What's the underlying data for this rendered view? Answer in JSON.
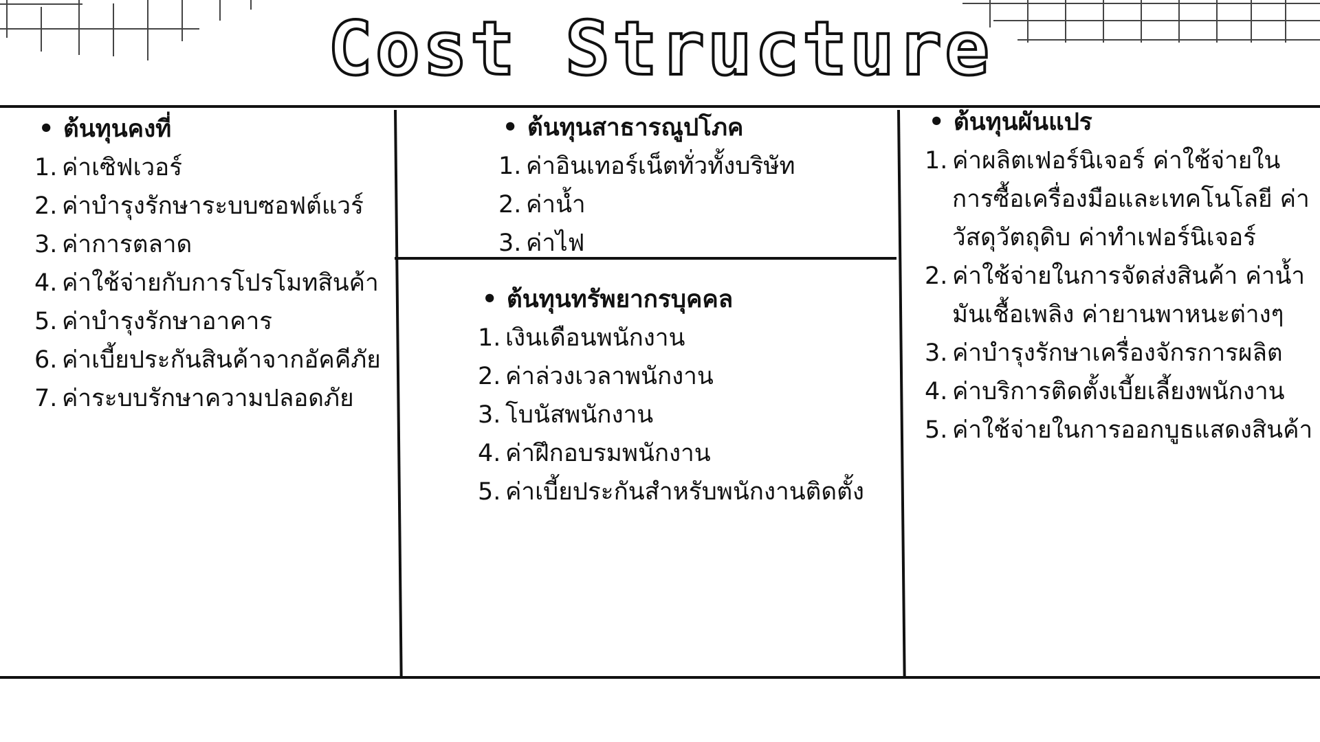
{
  "title": "Cost Structure",
  "colors": {
    "ink": "#111111",
    "background": "#ffffff"
  },
  "sections": {
    "fixed": {
      "heading": "ต้นทุนคงที่",
      "items": [
        {
          "num": "1.",
          "text": "ค่าเซิฟเวอร์"
        },
        {
          "num": "2.",
          "text": "ค่าบำรุงรักษาระบบซอฟต์แวร์"
        },
        {
          "num": "3.",
          "text": "ค่าการตลาด"
        },
        {
          "num": "4.",
          "text": "ค่าใช้จ่ายกับการโปรโมทสินค้า"
        },
        {
          "num": "5.",
          "text": "ค่าบำรุงรักษาอาคาร"
        },
        {
          "num": "6.",
          "text": "ค่าเบี้ยประกันสินค้าจากอัคคีภัย"
        },
        {
          "num": "7.",
          "text": "ค่าระบบรักษาความปลอดภัย"
        }
      ]
    },
    "utility": {
      "heading": "ต้นทุนสาธารณูปโภค",
      "items": [
        {
          "num": "1.",
          "text": "ค่าอินเทอร์เน็ตทั่วทั้งบริษัท"
        },
        {
          "num": "2.",
          "text": "ค่าน้ำ"
        },
        {
          "num": "3.",
          "text": "ค่าไฟ"
        }
      ]
    },
    "hr": {
      "heading": "ต้นทุนทรัพยากรบุคคล",
      "items": [
        {
          "num": "1.",
          "text": "เงินเดือนพนักงาน"
        },
        {
          "num": "2.",
          "text": "ค่าล่วงเวลาพนักงาน"
        },
        {
          "num": "3.",
          "text": "โบนัสพนักงาน"
        },
        {
          "num": "4.",
          "text": "ค่าฝึกอบรมพนักงาน"
        },
        {
          "num": "5.",
          "text": "ค่าเบี้ยประกันสำหรับพนักงานติดตั้ง"
        }
      ]
    },
    "variable": {
      "heading": "ต้นทุนผันแปร",
      "items": [
        {
          "num": "1.",
          "text": "ค่าผลิตเฟอร์นิเจอร์ ค่าใช้จ่ายในการซื้อเครื่องมือและเทคโนโลยี ค่าวัสดุวัตถุดิบ ค่าทำเฟอร์นิเจอร์"
        },
        {
          "num": "2.",
          "text": "ค่าใช้จ่ายในการจัดส่งสินค้า ค่าน้ำมันเชื้อเพลิง ค่ายานพาหนะต่างๆ"
        },
        {
          "num": "3.",
          "text": "ค่าบำรุงรักษาเครื่องจักรการผลิต"
        },
        {
          "num": "4.",
          "text": "ค่าบริการติดตั้งเบี้ยเลี้ยงพนักงาน"
        },
        {
          "num": "5.",
          "text": "ค่าใช้จ่ายในการออกบูธแสดงสินค้า"
        }
      ]
    }
  }
}
